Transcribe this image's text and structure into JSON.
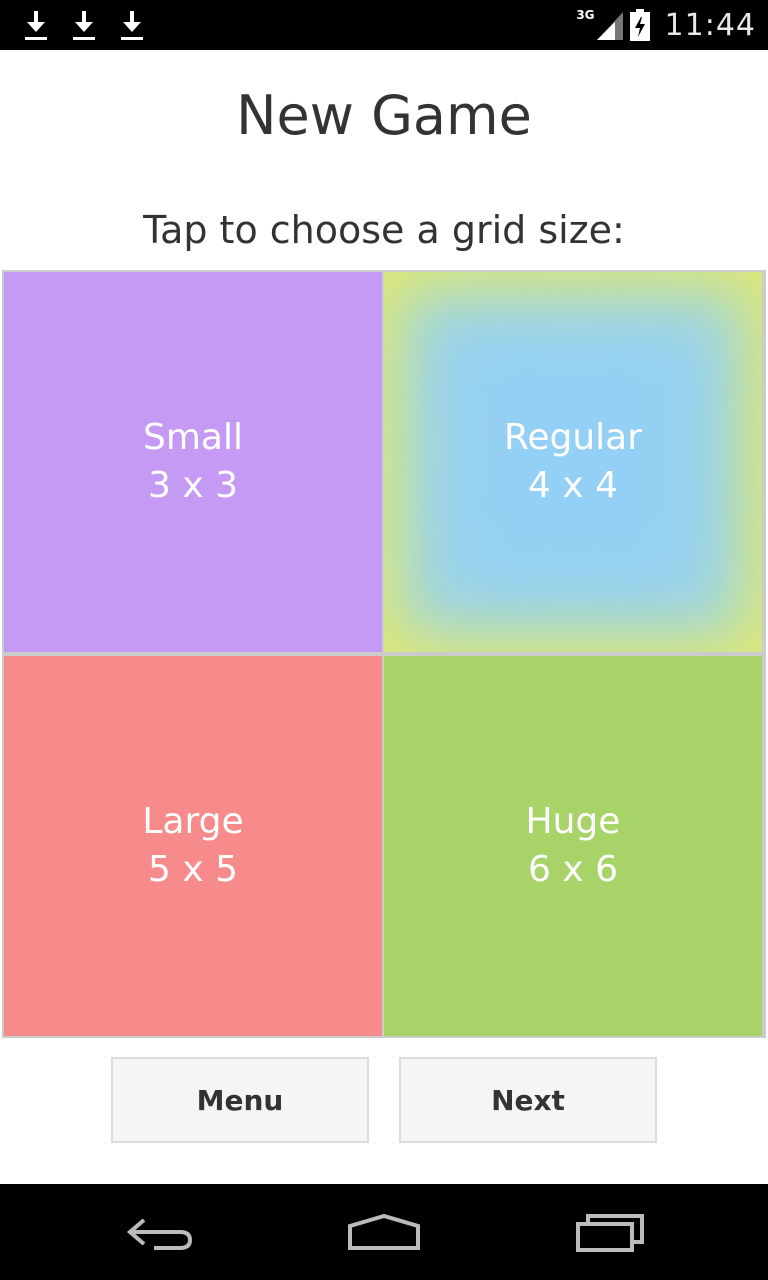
{
  "status_bar": {
    "notifications": [
      "download-icon",
      "download-icon",
      "download-icon"
    ],
    "network": "3G",
    "time": "11:44"
  },
  "screen": {
    "title": "New Game",
    "subtitle": "Tap to choose a grid size:"
  },
  "grid_options": [
    {
      "name": "Small",
      "size": "3 x 3",
      "color": "#c59af5"
    },
    {
      "name": "Regular",
      "size": "4 x 4",
      "color": "#94d0f5"
    },
    {
      "name": "Large",
      "size": "5 x 5",
      "color": "#f78a8a"
    },
    {
      "name": "Huge",
      "size": "6 x 6",
      "color": "#a8d369"
    }
  ],
  "buttons": {
    "menu": "Menu",
    "next": "Next"
  },
  "nav_bar": {
    "icons": [
      "back-icon",
      "home-icon",
      "recent-apps-icon"
    ]
  }
}
